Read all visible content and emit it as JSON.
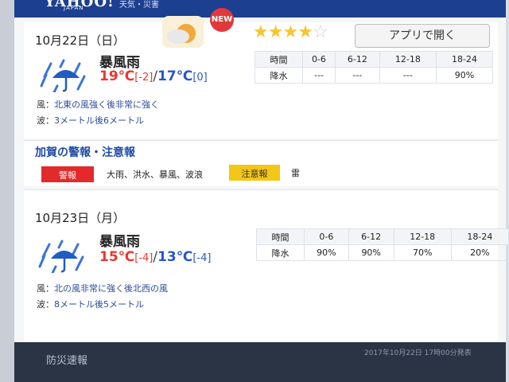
{
  "header": {
    "logo": "YAHOO!",
    "logo_sub": "JAPAN",
    "extra": "天気・災害"
  },
  "days": [
    {
      "date": "10月22日（日）",
      "condition": "暴風雨",
      "high": "19℃",
      "high_diff": "[-2]",
      "low": "17℃",
      "low_diff": "[0]",
      "table": {
        "time_label": "時間",
        "rain_label": "降水",
        "slots": [
          "0-6",
          "6-12",
          "12-18",
          "18-24"
        ],
        "rain": [
          "---",
          "---",
          "---",
          "90%"
        ]
      },
      "wind_label": "風：",
      "wind": "北東の風強く後非常に強く",
      "wave_label": "波：",
      "wave": "3メートル後6メートル"
    },
    {
      "date": "10月23日（月）",
      "condition": "暴風雨",
      "high": "15℃",
      "high_diff": "[-4]",
      "low": "13℃",
      "low_diff": "[-4]",
      "table": {
        "time_label": "時間",
        "rain_label": "降水",
        "slots": [
          "0-6",
          "6-12",
          "12-18",
          "18-24"
        ],
        "rain": [
          "90%",
          "90%",
          "70%",
          "20%"
        ]
      },
      "wind_label": "風：",
      "wind": "北の風非常に強く後北西の風",
      "wave_label": "波：",
      "wave": "8メートル後5メートル"
    }
  ],
  "warnings": {
    "title": "加賀の警報・注意報",
    "red_label": "警報",
    "red_items": "大雨、洪水、暴風、波浪",
    "yellow_label": "注意報",
    "yellow_items": "雷"
  },
  "footer": {
    "left": "防災速報",
    "date": "2017年10月22日 17時00分発表",
    "new_badge": "NEW",
    "rating": 4,
    "app_button": "アプリで開く"
  },
  "colors": {
    "accent": "#1e4ba6",
    "warning": "#e22a2a",
    "advisory": "#f3c618",
    "high": "#e8382e",
    "low": "#2b56c9"
  }
}
